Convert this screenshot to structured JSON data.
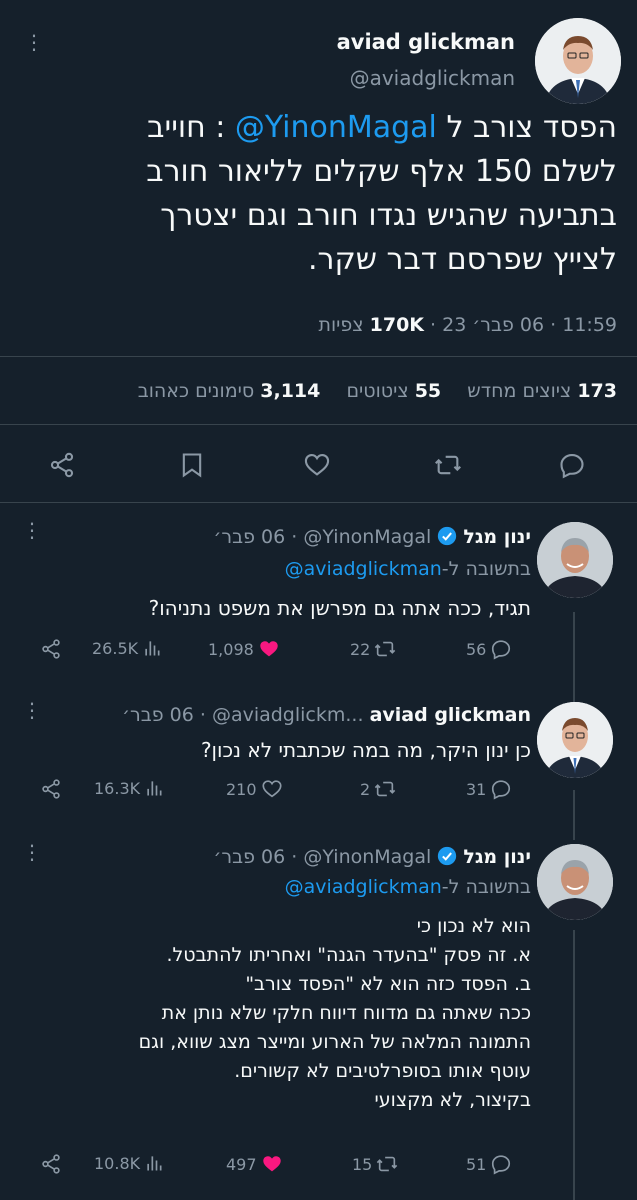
{
  "main_tweet": {
    "author_name": "aviad glickman",
    "handle": "@aviadglickman",
    "text_before_mention": "הפסד צורב ל ",
    "mention": "@YinonMagal",
    "text_line1_after": " : חוייב",
    "text_line2": "לשלם 150 אלף שקלים לליאור חורב",
    "text_line3": "בתביעה שהגיש נגדו חורב וגם יצטרך",
    "text_line4": "לצייץ שפרסם דבר שקר.",
    "time": "11:59",
    "date": "06 פבר׳ 23",
    "views_count": "170K",
    "views_label": "צפיות",
    "retweets_count": "173",
    "retweets_label": "ציוצים מחדש",
    "quotes_count": "55",
    "quotes_label": "ציטוטים",
    "likes_count": "3,114",
    "likes_label": "סימונים כאהוב"
  },
  "replies": [
    {
      "author_name": "ינון מגל",
      "handle": "@YinonMagal",
      "date": "06 פבר׳",
      "replying_prefix": "בתשובה ל-",
      "replying_to": "@aviadglickman",
      "lines": [
        "תגיד, ככה אתה גם מפרשן את משפט נתניהו?"
      ],
      "replies_count": "56",
      "retweets_count": "22",
      "likes_count": "1,098",
      "views_count": "26.5K"
    },
    {
      "author_name": "aviad glickman",
      "handle": "@aviadglickm...",
      "date": "06 פבר׳",
      "lines": [
        "כן ינון היקר, מה במה שכתבתי לא נכון?"
      ],
      "replies_count": "31",
      "retweets_count": "2",
      "likes_count": "210",
      "views_count": "16.3K"
    },
    {
      "author_name": "ינון מגל",
      "handle": "@YinonMagal",
      "date": "06 פבר׳",
      "replying_prefix": "בתשובה ל-",
      "replying_to": "@aviadglickman",
      "lines": [
        "הוא לא נכון כי",
        "א. זה פסק \"בהעדר הגנה\" ואחריתו להתבטל.",
        "ב. הפסד כזה הוא לא \"הפסד צורב\"",
        "ככה שאתה גם מדווח דיווח חלקי שלא נותן את",
        "התמונה המלאה של הארוע ומייצר מצג שווא, וגם",
        "עוטף אותו בסופרלטיבים לא קשורים.",
        "בקיצור, לא מקצועי"
      ],
      "replies_count": "51",
      "retweets_count": "15",
      "likes_count": "497",
      "views_count": "10.8K"
    }
  ],
  "colors": {
    "background": "#15202b",
    "text": "#f7f9f9",
    "secondary": "#8b98a5",
    "accent": "#1d9bf0",
    "like": "#f91880",
    "divider": "#38444d"
  },
  "icons": [
    "more-icon",
    "reply-icon",
    "retweet-icon",
    "like-icon",
    "bookmark-icon",
    "share-icon",
    "views-icon",
    "verified-icon"
  ]
}
